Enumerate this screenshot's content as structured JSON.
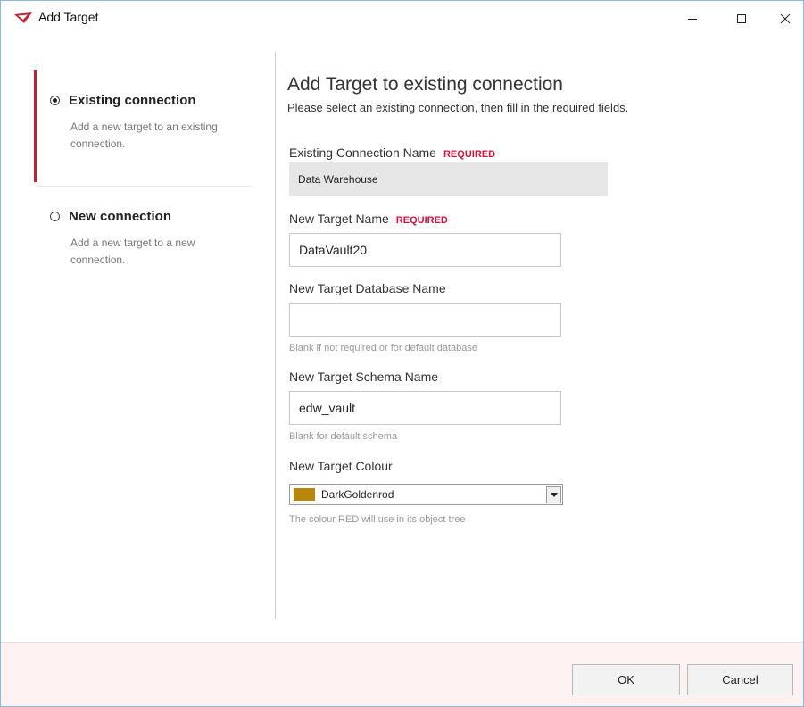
{
  "window": {
    "title": "Add Target",
    "brand_color": "#c8202e",
    "controls": [
      "minimize-icon",
      "maximize-icon",
      "close-icon"
    ]
  },
  "sidebar": {
    "options": [
      {
        "label": "Existing connection",
        "description": "Add a new target to an existing connection.",
        "selected": true
      },
      {
        "label": "New connection",
        "description": "Add a new target to a new connection.",
        "selected": false
      }
    ]
  },
  "form": {
    "heading": "Add Target to existing connection",
    "subheading": "Please select an existing connection, then fill in the required fields.",
    "required_label": "REQUIRED",
    "existing_connection": {
      "label": "Existing Connection Name",
      "value": "Data Warehouse"
    },
    "target_name": {
      "label": "New Target Name",
      "value": "DataVault20"
    },
    "database_name": {
      "label": "New Target Database Name",
      "value": "",
      "hint": "Blank if not required or for default database"
    },
    "schema_name": {
      "label": "New Target Schema Name",
      "value": "edw_vault",
      "hint": "Blank for default schema"
    },
    "colour": {
      "label": "New Target Colour",
      "value": "DarkGoldenrod",
      "swatch": "#b8860b",
      "hint": "The colour RED will use in its object tree"
    }
  },
  "footer": {
    "ok_label": "OK",
    "cancel_label": "Cancel"
  }
}
